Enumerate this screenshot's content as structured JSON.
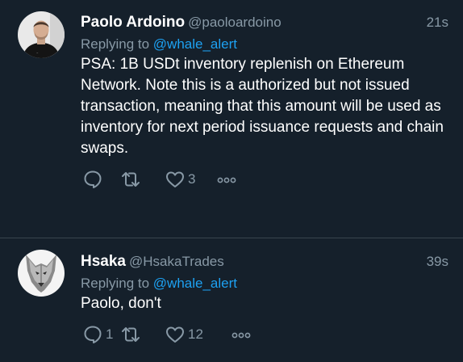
{
  "tweets": [
    {
      "name": "Paolo Ardoino",
      "handle": "@paoloardoino",
      "time": "21s",
      "reply_prefix": "Replying to",
      "reply_to": "@whale_alert",
      "text": "PSA: 1B USDt inventory replenish on Ethereum Network. Note this is a authorized but not issued transaction, meaning that this amount will be used as inventory for next period issuance requests and chain swaps.",
      "reply_count": "",
      "retweet_count": "",
      "like_count": "3",
      "avatar_icon": "person-photo"
    },
    {
      "name": "Hsaka",
      "handle": "@HsakaTrades",
      "time": "39s",
      "reply_prefix": "Replying to",
      "reply_to": "@whale_alert",
      "text": "Paolo, don't",
      "reply_count": "1",
      "retweet_count": "",
      "like_count": "12",
      "avatar_icon": "wolf-head"
    }
  ],
  "colors": {
    "background": "#15202b",
    "divider": "#38444d",
    "secondary_text": "#8899a6",
    "link": "#1da1f2",
    "primary_text": "#ffffff"
  }
}
